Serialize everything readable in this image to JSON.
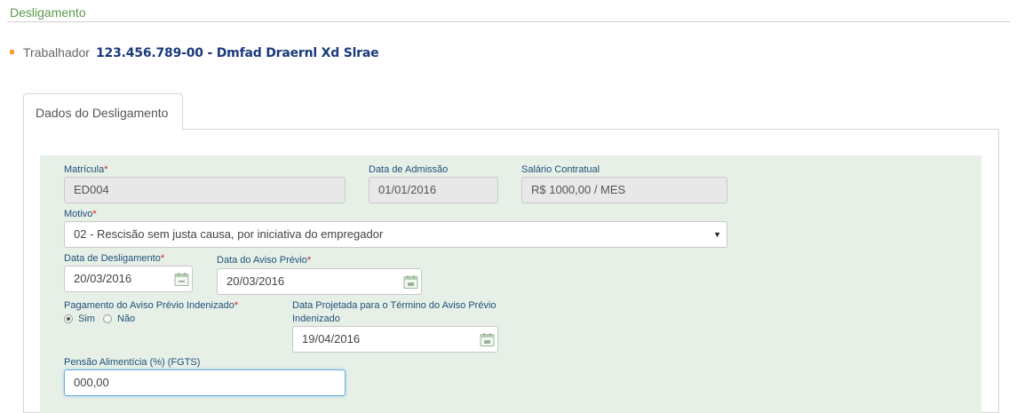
{
  "page": {
    "title": "Desligamento"
  },
  "worker": {
    "label": "Trabalhador",
    "value": "123.456.789-00 - Dmfad Draernl Xd Slrae"
  },
  "tabs": [
    {
      "label": "Dados do Desligamento"
    }
  ],
  "form": {
    "matricula": {
      "label": "Matrícula",
      "required": "*",
      "value": "ED004"
    },
    "data_admissao": {
      "label": "Data de Admissão",
      "value": "01/01/2016"
    },
    "salario": {
      "label": "Salário Contratual",
      "value": "R$ 1000,00 / MES"
    },
    "motivo": {
      "label": "Motivo",
      "required": "*",
      "value": "02 - Rescisão sem justa causa, por iniciativa do empregador"
    },
    "data_desligamento": {
      "label": "Data de Desligamento",
      "required": "*",
      "value": "20/03/2016"
    },
    "data_aviso": {
      "label": "Data do Aviso Prévio",
      "required": "*",
      "value": "20/03/2016"
    },
    "pagamento_aviso": {
      "label": "Pagamento do Aviso Prévio Indenizado",
      "required": "*",
      "options": [
        {
          "label": "Sim",
          "checked": true
        },
        {
          "label": "Não",
          "checked": false
        }
      ]
    },
    "data_projetada": {
      "label_line1": "Data Projetada para o Término do Aviso Prévio",
      "label_line2": "Indenizado",
      "value": "19/04/2016"
    },
    "pensao": {
      "label": "Pensão Alimentícia (%) (FGTS)",
      "value": "000,00"
    }
  },
  "colors": {
    "title": "#5a9a4a",
    "worker_value": "#1a3a7a",
    "label": "#1f4f7a",
    "required": "#cc2222",
    "form_background": "#e7f0e7",
    "bullet": "#f0a030"
  },
  "icons": {
    "calendar": "calendar-icon",
    "select_caret": "caret-down-icon",
    "bullet": "square-bullet-icon"
  }
}
